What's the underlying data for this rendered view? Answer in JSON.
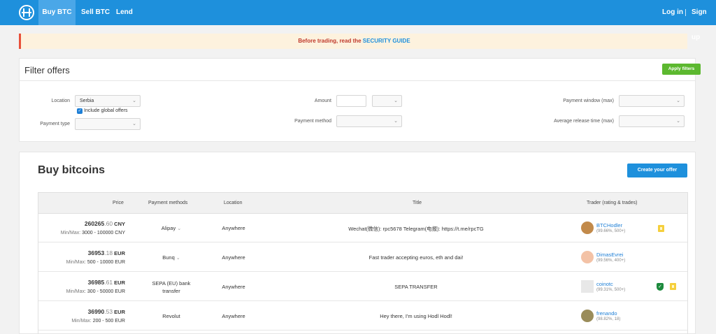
{
  "nav": {
    "logo_icon": "hodlhodl-logo-icon",
    "tabs": [
      {
        "label": "Buy BTC",
        "active": true
      },
      {
        "label": "Sell BTC",
        "active": false
      },
      {
        "label": "Lend",
        "active": false
      }
    ],
    "login": "Log in",
    "signup": "Sign up"
  },
  "banner": {
    "text": "Before trading, read the ",
    "link": "SECURITY GUIDE"
  },
  "filters": {
    "title": "Filter offers",
    "apply_button": "Apply filters",
    "location_label": "Location",
    "location_value": "Serbia",
    "include_global_label": "Include global offers",
    "include_global_checked": true,
    "payment_type_label": "Payment type",
    "payment_type_value": "",
    "amount_label": "Amount",
    "amount_value": "",
    "currency_value": "",
    "payment_method_label": "Payment method",
    "payment_method_value": "",
    "payment_window_label": "Payment window (max)",
    "payment_window_value": "",
    "release_time_label": "Average release time (max)",
    "release_time_value": ""
  },
  "buy": {
    "title": "Buy bitcoins",
    "create_button": "Create your offer",
    "columns": [
      "Price",
      "Payment methods",
      "Location",
      "Title",
      "Trader (rating & trades)"
    ],
    "min_max_label": "Min/Max: ",
    "rows": [
      {
        "price_main": "260265",
        "price_cents": ".60",
        "currency": " CNY",
        "min_max": "3000 - 100000 CNY",
        "payment": "Alipay",
        "payment_dropdown": true,
        "location": "Anywhere",
        "title": "Wechat(微信): rpc5678 Telegram(电报): https://t.me/rpcTG",
        "trader": "BTCHodler",
        "stats": "(99.66%, 500+)",
        "verified": false,
        "avatar_color": "#c28a4a"
      },
      {
        "price_main": "36953",
        "price_cents": ".18",
        "currency": " EUR",
        "min_max": "500 - 10000 EUR",
        "payment": "Bunq",
        "payment_dropdown": true,
        "location": "Anywhere",
        "title": "Fast trader accepting euros, eth and dai!",
        "trader": "DimasEvrei",
        "stats": "(99.56%, 400+)",
        "verified": false,
        "avatar_color": "#f3c2a6"
      },
      {
        "price_main": "36985",
        "price_cents": ".61",
        "currency": " EUR",
        "min_max": "300 - 50000 EUR",
        "payment": "SEPA (EU) bank transfer",
        "payment_dropdown": false,
        "location": "Anywhere",
        "title": "SEPA TRANSFER",
        "trader": "coinotc",
        "stats": "(99.31%, 500+)",
        "verified": true,
        "avatar_color": "#e8e8e8"
      },
      {
        "price_main": "36990",
        "price_cents": ".53",
        "currency": " EUR",
        "min_max": "200 - 500 EUR",
        "payment": "Revolut",
        "payment_dropdown": false,
        "location": "Anywhere",
        "title": "Hey there, I'm using Hodl Hodl!",
        "trader": "frenando",
        "stats": "(98.82%, 18)",
        "verified": false,
        "avatar_color": "#9a8c5a"
      }
    ]
  },
  "colors": {
    "nav": "#1e90dc",
    "nav_active": "#4aa7e8",
    "apply": "#5cb82f",
    "link": "#1e7fd6",
    "banner_bg": "#fdf2de",
    "banner_text": "#c0392b"
  }
}
